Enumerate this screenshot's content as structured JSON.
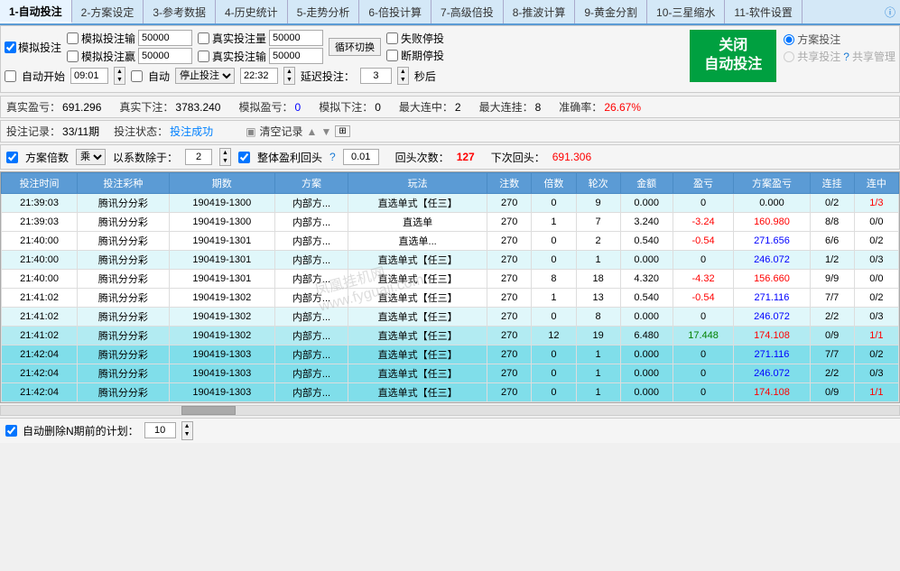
{
  "tabs": [
    {
      "id": "tab1",
      "label": "1-自动投注",
      "active": true
    },
    {
      "id": "tab2",
      "label": "2-方案设定",
      "active": false
    },
    {
      "id": "tab3",
      "label": "3-参考数据",
      "active": false
    },
    {
      "id": "tab4",
      "label": "4-历史统计",
      "active": false
    },
    {
      "id": "tab5",
      "label": "5-走势分析",
      "active": false
    },
    {
      "id": "tab6",
      "label": "6-倍投计算",
      "active": false
    },
    {
      "id": "tab7",
      "label": "7-高级倍投",
      "active": false
    },
    {
      "id": "tab8",
      "label": "8-推波计算",
      "active": false
    },
    {
      "id": "tab9",
      "label": "9-黄金分割",
      "active": false
    },
    {
      "id": "tab10",
      "label": "10-三星缩水",
      "active": false
    },
    {
      "id": "tab11",
      "label": "11-软件设置",
      "active": false
    }
  ],
  "controls": {
    "mock_bet_label": "模拟投注",
    "mock_input_label": "模拟投注输",
    "mock_input_value": "50000",
    "mock_win_label": "模拟投注赢",
    "mock_win_value": "50000",
    "real_bet_limit_label": "真实投注量",
    "real_bet_limit_value": "50000",
    "real_loss_label": "真实投注输",
    "real_loss_value": "50000",
    "loop_label": "循环切换",
    "fail_stop_label": "失败停投",
    "break_stop_label": "断期停投",
    "close_auto_label": "关闭\n自动投注",
    "plan_bet_label": "方案投注",
    "shared_bet_label": "共享投注",
    "shared_manage_label": "共享管理"
  },
  "time_controls": {
    "auto_start_label": "自动开始",
    "start_time": "09:01",
    "auto_label": "自动",
    "stop_label": "停止投注",
    "end_time": "22:32",
    "delay_label": "延迟投注：",
    "delay_value": "3",
    "delay_unit": "秒后"
  },
  "stats": {
    "real_profit_label": "真实盈亏：",
    "real_profit_value": "691.296",
    "real_orders_label": "真实下注：",
    "real_orders_value": "3783.240",
    "mock_profit_label": "模拟盈亏：",
    "mock_profit_value": "0",
    "mock_orders_label": "模拟下注：",
    "mock_orders_value": "0",
    "max_win_label": "最大连中：",
    "max_win_value": "2",
    "max_miss_label": "最大连挂：",
    "max_miss_value": "8",
    "accuracy_label": "准确率：",
    "accuracy_value": "26.67%"
  },
  "stats2": {
    "records_label": "投注记录：",
    "records_value": "33/11期",
    "status_label": "投注状态：",
    "status_value": "投注成功",
    "clear_label": "清空记录"
  },
  "plan": {
    "plan_times_label": "方案倍数",
    "plan_times_value": "乘",
    "divide_label": "以系数除于：",
    "divide_value": "2",
    "overall_profit_label": "整体盈利回头",
    "overall_profit_value": "0.01",
    "return_times_label": "回头次数：",
    "return_times_value": "127",
    "next_return_label": "下次回头：",
    "next_return_value": "691.306"
  },
  "table": {
    "headers": [
      "投注时间",
      "投注彩种",
      "期数",
      "方案",
      "玩法",
      "注数",
      "倍数",
      "轮次",
      "金额",
      "盈亏",
      "方案盈亏",
      "连挂",
      "连中"
    ],
    "rows": [
      {
        "time": "21:39:03",
        "type": "腾讯分分彩",
        "period": "190419-1300",
        "plan": "内部方...",
        "play": "直选单式【任三】",
        "notes": 270,
        "times": 0,
        "round": 9,
        "amount": 0,
        "profit": 0,
        "plan_profit": 0,
        "streak": "0/2",
        "hit": "1/3",
        "bg": "cyan"
      },
      {
        "time": "21:39:03",
        "type": "腾讯分分彩",
        "period": "190419-1300",
        "plan": "内部方...",
        "play": "直选单",
        "notes": 270,
        "times": 1,
        "round": 7,
        "amount": 3.24,
        "profit": -3.24,
        "plan_profit": 160.98,
        "streak": "8/8",
        "hit": "0/0",
        "bg": "white"
      },
      {
        "time": "21:40:00",
        "type": "腾讯分分彩",
        "period": "190419-1301",
        "plan": "内部方...",
        "play": "直选单...",
        "notes": 270,
        "times": 0,
        "round": 2,
        "amount": 0.54,
        "profit": -0.54,
        "plan_profit": 271.656,
        "streak": "6/6",
        "hit": "0/2",
        "bg": "white"
      },
      {
        "time": "21:40:00",
        "type": "腾讯分分彩",
        "period": "190419-1301",
        "plan": "内部方...",
        "play": "直选单式【任三】",
        "notes": 270,
        "times": 0,
        "round": 1,
        "amount": 0,
        "profit": 0,
        "plan_profit": 246.072,
        "streak": "1/2",
        "hit": "0/3",
        "bg": "cyan"
      },
      {
        "time": "21:40:00",
        "type": "腾讯分分彩",
        "period": "190419-1301",
        "plan": "内部方...",
        "play": "直选单式【任三】",
        "notes": 270,
        "times": 8,
        "round": 18,
        "amount": 4.32,
        "profit": -4.32,
        "plan_profit": 156.66,
        "streak": "9/9",
        "hit": "0/0",
        "bg": "white"
      },
      {
        "time": "21:41:02",
        "type": "腾讯分分彩",
        "period": "190419-1302",
        "plan": "内部方...",
        "play": "直选单式【任三】",
        "notes": 270,
        "times": 1,
        "round": 13,
        "amount": 0.54,
        "profit": -0.54,
        "plan_profit": 271.116,
        "streak": "7/7",
        "hit": "0/2",
        "bg": "white"
      },
      {
        "time": "21:41:02",
        "type": "腾讯分分彩",
        "period": "190419-1302",
        "plan": "内部方...",
        "play": "直选单式【任三】",
        "notes": 270,
        "times": 0,
        "round": 8,
        "amount": 0,
        "profit": 0,
        "plan_profit": 246.072,
        "streak": "2/2",
        "hit": "0/3",
        "bg": "cyan"
      },
      {
        "time": "21:41:02",
        "type": "腾讯分分彩",
        "period": "190419-1302",
        "plan": "内部方...",
        "play": "直选单式【任三】",
        "notes": 270,
        "times": 12,
        "round": 19,
        "amount": 6.48,
        "profit": 17.448,
        "plan_profit": 174.108,
        "streak": "0/9",
        "hit": "1/1",
        "bg": "highlight"
      },
      {
        "time": "21:42:04",
        "type": "腾讯分分彩",
        "period": "190419-1303",
        "plan": "内部方...",
        "play": "直选单式【任三】",
        "notes": 270,
        "times": 0,
        "round": 1,
        "amount": 0,
        "profit": 0,
        "plan_profit": 271.116,
        "streak": "7/7",
        "hit": "0/2",
        "bg": "selected"
      },
      {
        "time": "21:42:04",
        "type": "腾讯分分彩",
        "period": "190419-1303",
        "plan": "内部方...",
        "play": "直选单式【任三】",
        "notes": 270,
        "times": 0,
        "round": 1,
        "amount": 0,
        "profit": 0,
        "plan_profit": 246.072,
        "streak": "2/2",
        "hit": "0/3",
        "bg": "selected"
      },
      {
        "time": "21:42:04",
        "type": "腾讯分分彩",
        "period": "190419-1303",
        "plan": "内部方...",
        "play": "直选单式【任三】",
        "notes": 270,
        "times": 0,
        "round": 1,
        "amount": 0,
        "profit": 0,
        "plan_profit": 174.108,
        "streak": "0/9",
        "hit": "1/1",
        "bg": "selected"
      }
    ]
  },
  "bottom": {
    "auto_delete_label": "自动删除N期前的计划：",
    "auto_delete_value": "10"
  },
  "watermark": "凤凰挂机网\nwww.fyguaji.com"
}
